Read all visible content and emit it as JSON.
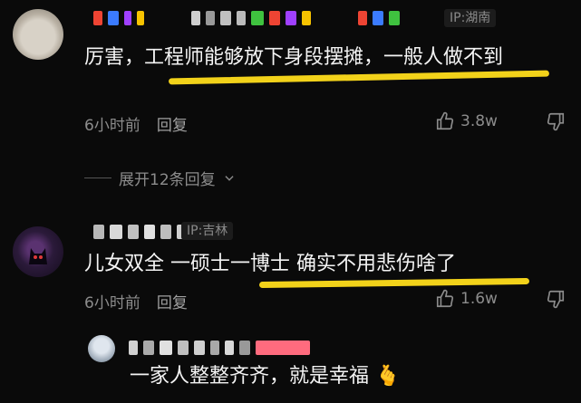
{
  "comments": [
    {
      "ip": "IP:湖南",
      "text": "厉害，工程师能够放下身段摆摊，一般人做不到",
      "time": "6小时前",
      "reply": "回复",
      "likes": "3.8w",
      "expand": "展开12条回复"
    },
    {
      "ip": "IP:吉林",
      "text": "儿女双全 一硕士一博士 确实不用悲伤啥了",
      "time": "6小时前",
      "reply": "回复",
      "likes": "1.6w"
    },
    {
      "text": "一家人整整齐齐，就是幸福",
      "emoji": "🫰"
    }
  ],
  "colors": {
    "highlight": "#f2d21a",
    "background": "#0a0a0a"
  },
  "icons": [
    "thumb-up-icon",
    "thumb-down-icon",
    "chevron-down-icon"
  ]
}
